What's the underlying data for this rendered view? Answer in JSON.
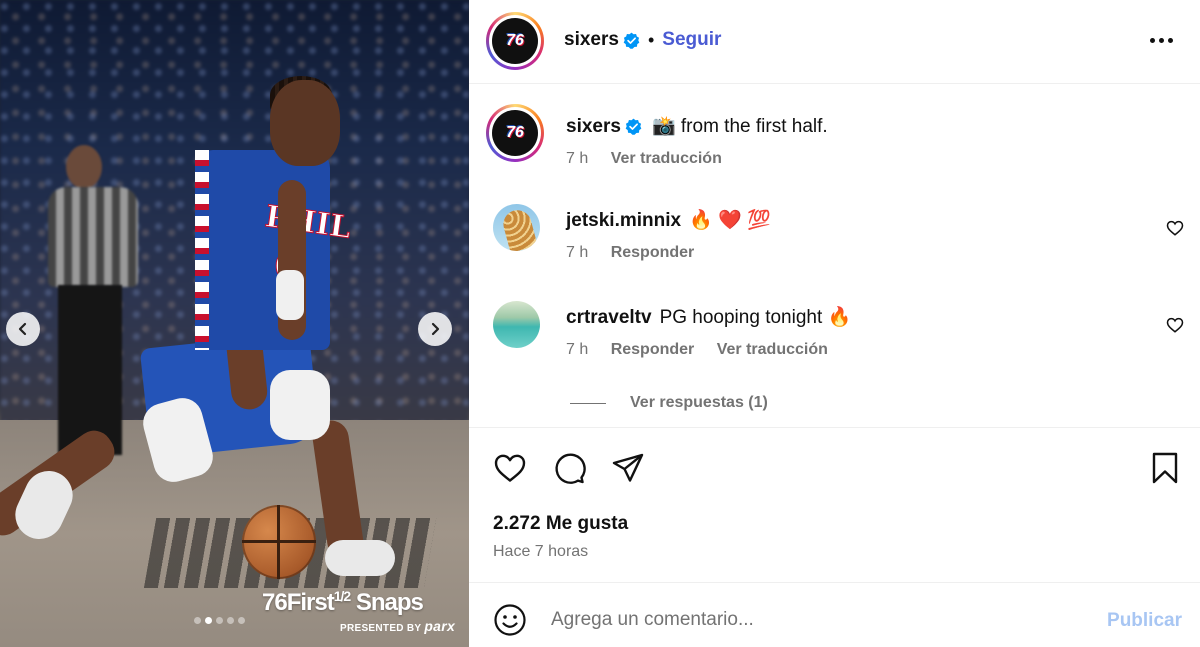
{
  "media": {
    "image_alt": "Photo of a 76ers player in a blue PHILA #0 jersey dribbling a basketball on court",
    "brand_text": "76First",
    "brand_fraction": "1/2",
    "brand_suffix": "Snaps",
    "presented_by": "PRESENTED BY",
    "sponsor": "parx",
    "carousel_total": 5,
    "carousel_active": 1
  },
  "header": {
    "username": "sixers",
    "verified": true,
    "separator": "•",
    "follow_label": "Seguir"
  },
  "caption": {
    "username": "sixers",
    "emoji": "📸",
    "text": "from the first half.",
    "time": "7 h",
    "translate_label": "Ver traducción"
  },
  "comments": [
    {
      "username": "jetski.minnix",
      "text": "🔥 ❤️ 💯",
      "time": "7 h",
      "reply_label": "Responder",
      "translate_label": ""
    },
    {
      "username": "crtraveltv",
      "text": "PG hooping tonight 🔥",
      "time": "7 h",
      "reply_label": "Responder",
      "translate_label": "Ver traducción"
    }
  ],
  "view_replies_label": "Ver respuestas (1)",
  "stats": {
    "likes": "2.272 Me gusta",
    "posted": "Hace 7 horas"
  },
  "composer": {
    "placeholder": "Agrega un comentario...",
    "publish_label": "Publicar"
  },
  "colors": {
    "accent": "#4a5bd3",
    "verified": "#0095f6",
    "muted_text": "#737373",
    "publish_disabled": "#a8c6f3"
  },
  "icons": [
    "chevron-left-icon",
    "chevron-right-icon",
    "verified-icon",
    "more-icon",
    "heart-icon",
    "comment-icon",
    "share-icon",
    "bookmark-icon",
    "emoji-icon"
  ]
}
